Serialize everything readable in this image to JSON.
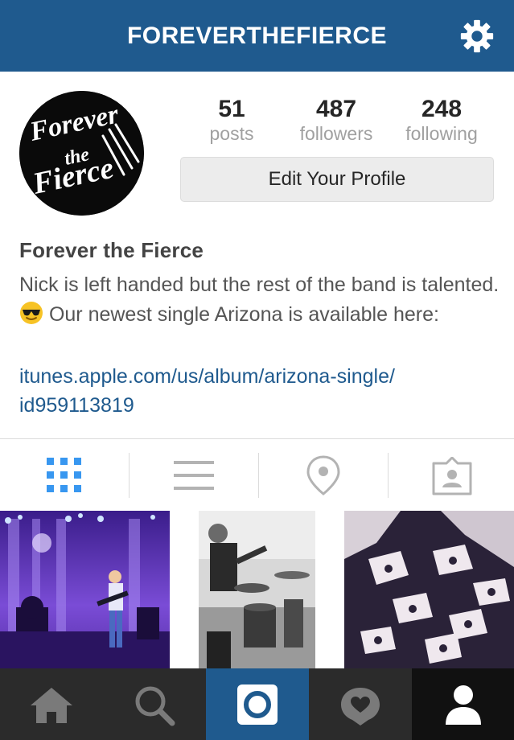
{
  "header": {
    "title": "FOREVERTHEFIERCE",
    "settings_icon": "gear-icon"
  },
  "profile": {
    "avatar_text": "Forever the Fierce",
    "stats": [
      {
        "value": "51",
        "label": "posts"
      },
      {
        "value": "487",
        "label": "followers"
      },
      {
        "value": "248",
        "label": "following"
      }
    ],
    "edit_button": "Edit Your Profile",
    "name": "Forever the Fierce",
    "bio_part1": "Nick is left handed but the rest of the band is talented.",
    "bio_part2": "Our newest single Arizona is available here:",
    "bio_emoji": "sunglasses-emoji",
    "link_line1": "itunes.apple.com/us/album/arizona-single/",
    "link_line2": "id959113819"
  },
  "tabs": [
    {
      "icon": "grid-icon",
      "active": true
    },
    {
      "icon": "list-icon",
      "active": false
    },
    {
      "icon": "location-pin-icon",
      "active": false
    },
    {
      "icon": "tagged-photos-icon",
      "active": false
    }
  ],
  "photos": [
    {
      "subject": "concert-stage-photo"
    },
    {
      "subject": "drummer-photo"
    },
    {
      "subject": "merch-shirt-photo"
    }
  ],
  "bottom_nav": [
    {
      "icon": "home-icon",
      "active": false
    },
    {
      "icon": "search-icon",
      "active": false
    },
    {
      "icon": "camera-icon",
      "active": false
    },
    {
      "icon": "activity-icon",
      "active": false
    },
    {
      "icon": "profile-icon",
      "active": true
    }
  ],
  "colors": {
    "header_bg": "#1f5a8e",
    "link": "#1f5a8e",
    "active_tab": "#3897f0",
    "inactive_icon": "#b3b3b3",
    "nav_bg": "#2b2b2b",
    "nav_camera_bg": "#1f5a8e"
  }
}
